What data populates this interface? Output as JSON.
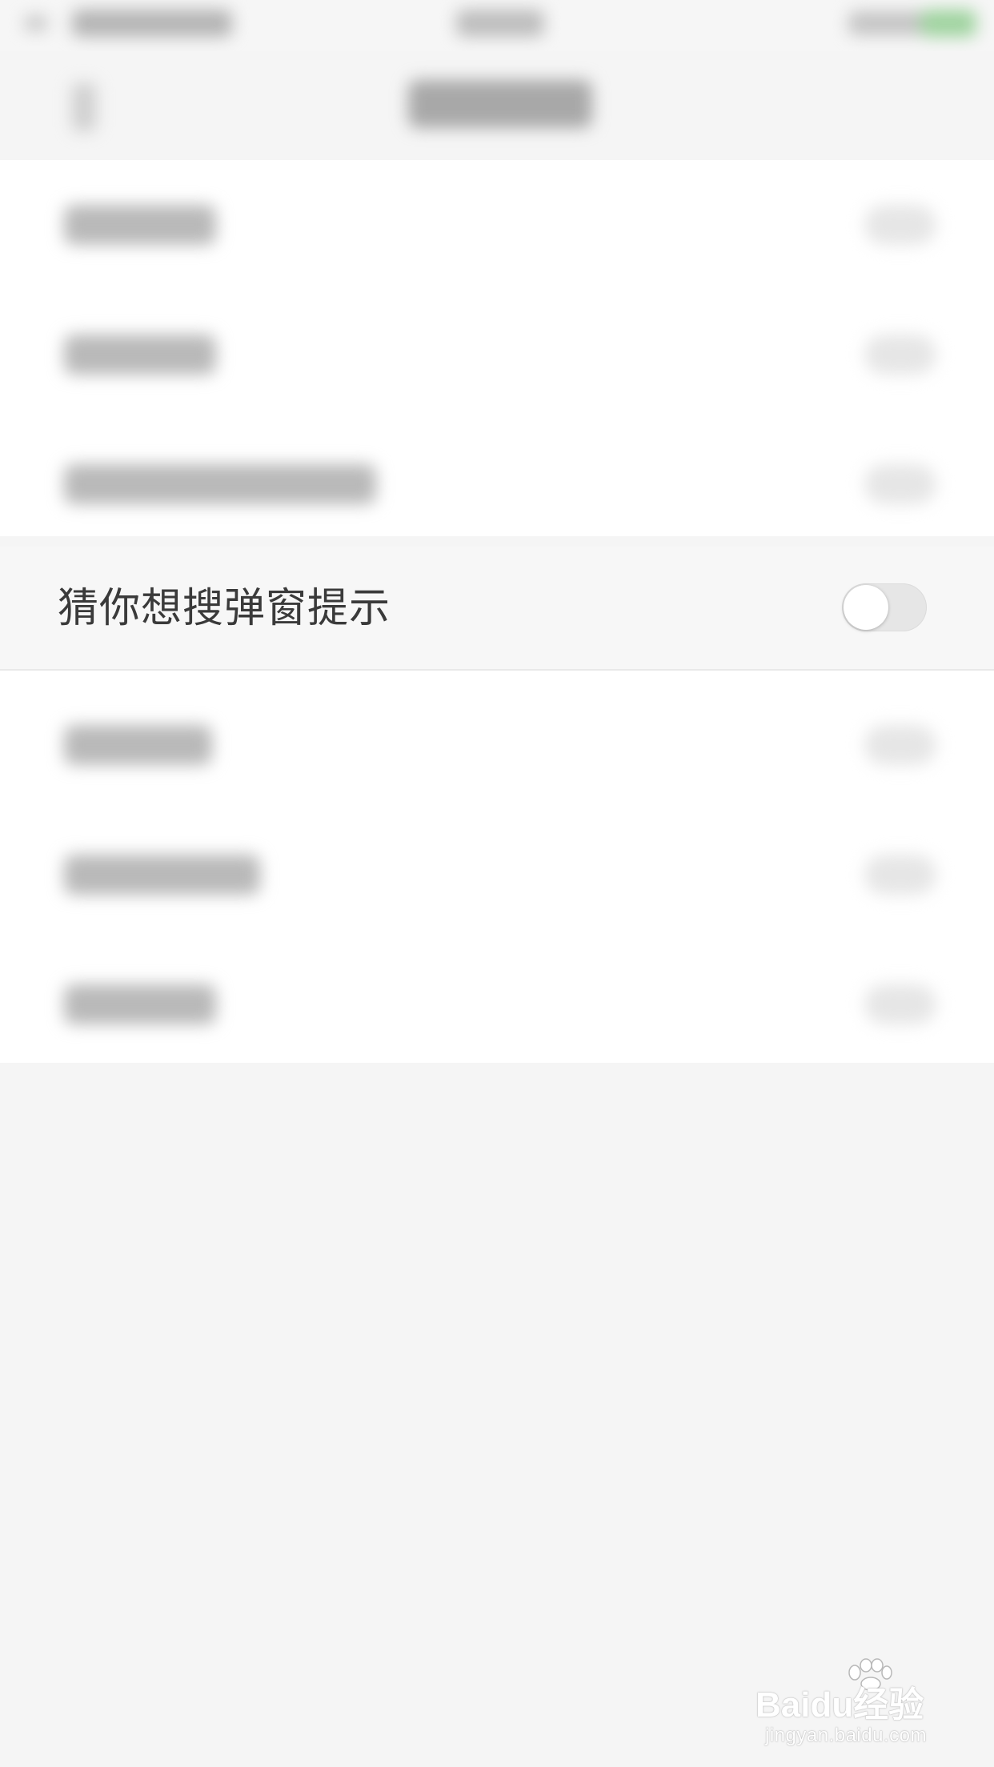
{
  "setting": {
    "label": "猜你想搜弹窗提示",
    "toggle_on": false
  },
  "watermark": {
    "logo_text": "Baidu经验",
    "url": "jingyan.baidu.com"
  },
  "colors": {
    "background": "#f5f5f5",
    "row_highlight": "#f7f7f7",
    "toggle_track_off": "#e6e6e6",
    "toggle_knob": "#ffffff",
    "label_text": "#3a3a3a"
  }
}
